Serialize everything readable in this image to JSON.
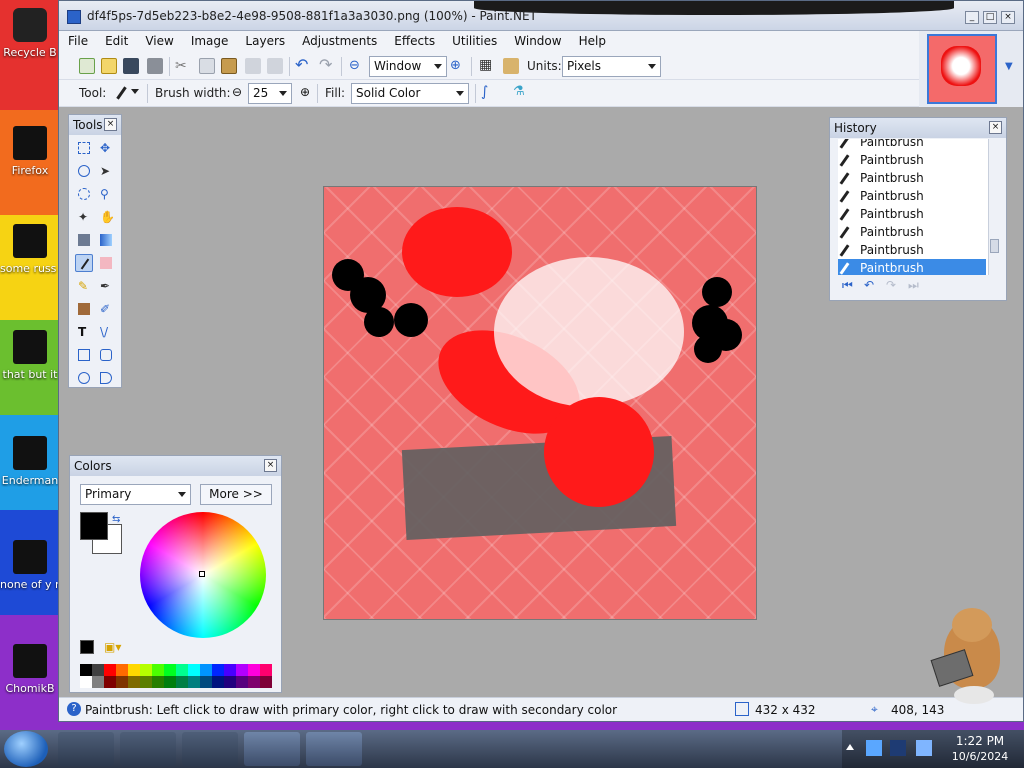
{
  "window": {
    "title": "df4f5ps-7d5eb223-b8e2-4e98-9508-881f1a3a3030.png (100%) - Paint.NET"
  },
  "menu": [
    "File",
    "Edit",
    "View",
    "Image",
    "Layers",
    "Adjustments",
    "Effects",
    "Utilities",
    "Window",
    "Help"
  ],
  "toolbar": {
    "zoom_value": "Window",
    "units_label": "Units:",
    "units_value": "Pixels",
    "tool_label": "Tool:",
    "brush_width_label": "Brush width:",
    "brush_width_value": "25",
    "fill_label": "Fill:",
    "fill_value": "Solid Color"
  },
  "panels": {
    "tools_title": "Tools",
    "history_title": "History",
    "colors_title": "Colors",
    "colors_mode": "Primary",
    "colors_more": "More >>"
  },
  "history": {
    "items": [
      "Paintbrush",
      "Paintbrush",
      "Paintbrush",
      "Paintbrush",
      "Paintbrush",
      "Paintbrush",
      "Paintbrush",
      "Paintbrush"
    ],
    "selected_index": 7
  },
  "status": {
    "hint": "Paintbrush: Left click to draw with primary color, right click to draw with secondary color",
    "image_size": "432 x 432",
    "cursor_pos": "408, 143"
  },
  "desktop_icons": [
    "Recycle B",
    "Firefox",
    "some russ ran a ra",
    "that but it",
    "Enderman",
    "none of y retards kn",
    "ChomikB"
  ],
  "taskbar": {
    "time": "1:22 PM",
    "date": "10/6/2024"
  },
  "colors": {
    "primary": "#000000",
    "secondary": "#ffffff",
    "accent": "#3b8be6"
  }
}
